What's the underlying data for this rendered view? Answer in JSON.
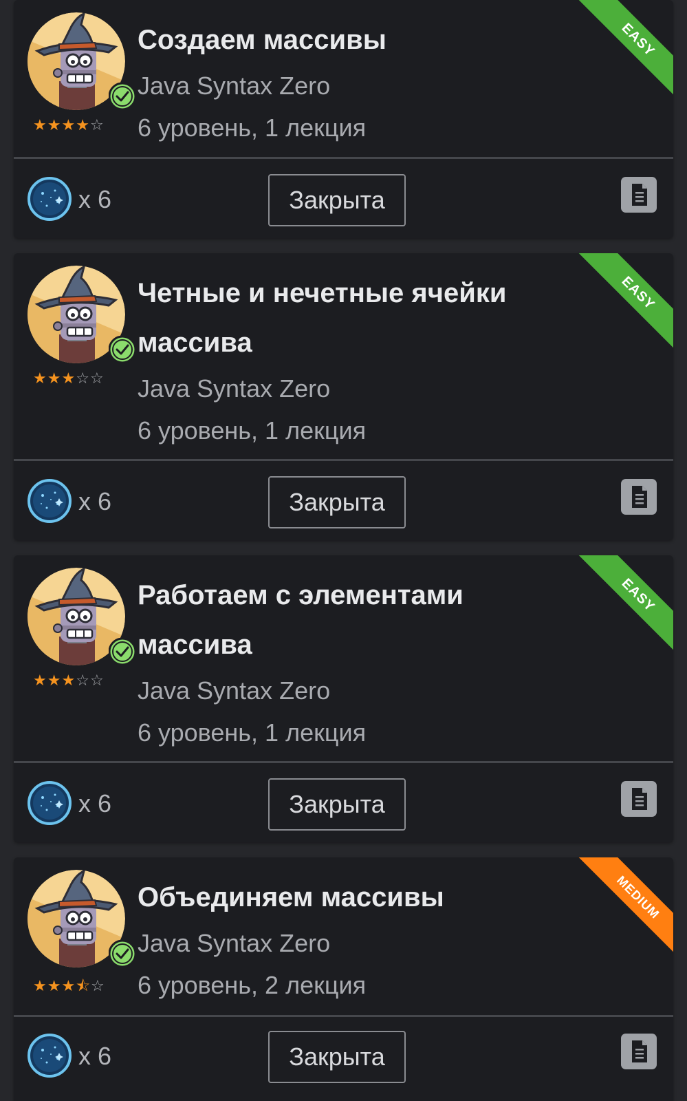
{
  "colors": {
    "page_bg": "#26272b",
    "card_bg": "#1c1d21",
    "easy": "#4caf3a",
    "medium": "#ff7f11",
    "star": "#f5931f",
    "check": "#8bdc6c"
  },
  "tasks": [
    {
      "title": "Создаем массивы",
      "course": "Java Syntax Zero",
      "level": "6 уровень, 1 лекция",
      "difficulty": "EASY",
      "rating": 4,
      "multiplier": "x 6",
      "status_label": "Закрыта",
      "avatar_icon": "robot-wizard-icon",
      "completed_icon": "check-icon",
      "coin_icon": "dark-matter-coin-icon",
      "doc_icon": "document-icon"
    },
    {
      "title": "Четные и нечетные ячейки массива",
      "course": "Java Syntax Zero",
      "level": "6 уровень, 1 лекция",
      "difficulty": "EASY",
      "rating": 3,
      "multiplier": "x 6",
      "status_label": "Закрыта",
      "avatar_icon": "robot-wizard-icon",
      "completed_icon": "check-icon",
      "coin_icon": "dark-matter-coin-icon",
      "doc_icon": "document-icon"
    },
    {
      "title": "Работаем с элементами массива",
      "course": "Java Syntax Zero",
      "level": "6 уровень, 1 лекция",
      "difficulty": "EASY",
      "rating": 3,
      "multiplier": "x 6",
      "status_label": "Закрыта",
      "avatar_icon": "robot-wizard-icon",
      "completed_icon": "check-icon",
      "coin_icon": "dark-matter-coin-icon",
      "doc_icon": "document-icon"
    },
    {
      "title": "Объединяем массивы",
      "course": "Java Syntax Zero",
      "level": "6 уровень, 2 лекция",
      "difficulty": "MEDIUM",
      "rating": 3.5,
      "multiplier": "x 6",
      "status_label": "Закрыта",
      "avatar_icon": "robot-wizard-icon",
      "completed_icon": "check-icon",
      "coin_icon": "dark-matter-coin-icon",
      "doc_icon": "document-icon"
    }
  ]
}
